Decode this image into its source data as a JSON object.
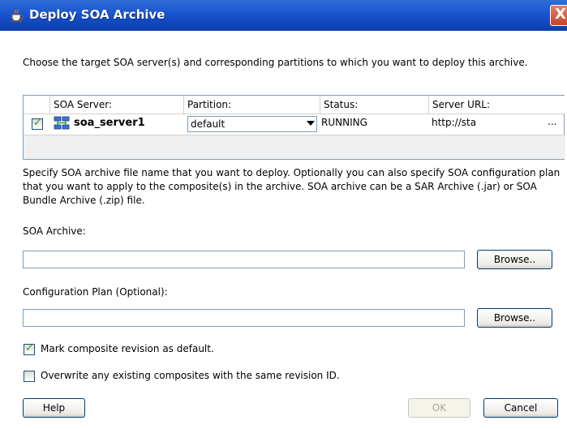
{
  "window": {
    "title": "Deploy SOA Archive",
    "close_glyph": "X"
  },
  "intro": "Choose the target SOA server(s) and corresponding partitions to which you want to deploy this archive.",
  "table": {
    "columns": [
      "SOA Server:",
      "Partition:",
      "Status:",
      "Server URL:"
    ],
    "rows": [
      {
        "checked": true,
        "server": "soa_server1",
        "partition": "default",
        "status": "RUNNING",
        "url": "http://sta",
        "more": "..."
      }
    ]
  },
  "description": "Specify SOA archive file name that you want to deploy. Optionally you can also specify SOA configuration plan that you want to apply to the composite(s) in the archive. SOA archive can be a SAR Archive (.jar) or SOA Bundle Archive (.zip) file.",
  "soa_archive": {
    "label": "SOA Archive:",
    "value": "",
    "browse_label": "Browse.."
  },
  "config_plan": {
    "label": "Configuration Plan (Optional):",
    "value": "",
    "browse_label": "Browse.."
  },
  "options": {
    "mark_default": {
      "label": "Mark composite revision as default.",
      "checked": true
    },
    "overwrite": {
      "label": "Overwrite any existing composites with the same revision ID.",
      "checked": false
    }
  },
  "buttons": {
    "help": "Help",
    "ok": "OK",
    "cancel": "Cancel"
  },
  "colors": {
    "titlebar": "#1d5ad0",
    "close": "#c2452b",
    "check": "#21a121"
  }
}
